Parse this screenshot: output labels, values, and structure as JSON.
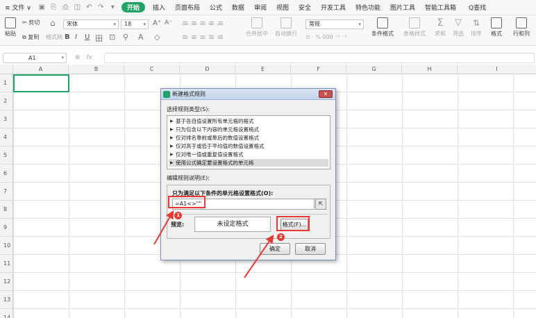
{
  "menubar": {
    "file": "≡ 文件 ∨",
    "tabs": [
      "开始",
      "插入",
      "页面布局",
      "公式",
      "数据",
      "审阅",
      "视图",
      "安全",
      "开发工具",
      "特色功能",
      "图片工具",
      "智能工具箱"
    ],
    "active_tab": "开始",
    "search": "Q查找"
  },
  "ribbon": {
    "cut": "✂ 剪切",
    "paste": "粘贴",
    "copy": "复制",
    "format_painter": "格式刷",
    "font": "宋体",
    "font_size": "18",
    "grow_font": "A⁺",
    "shrink_font": "A⁻",
    "bold": "B",
    "italic": "I",
    "underline": "U",
    "merge_center": "合并居中",
    "wrap": "自动换行",
    "number_format": "常规",
    "number_icons": "⊙ · % 000 ⁺⁰ ⁻⁰",
    "cond_format": "条件格式",
    "table_style": "表格样式",
    "sum": "求和",
    "filter": "筛选",
    "sort": "排序",
    "format": "格式",
    "rows_cols": "行和列"
  },
  "formula_bar": {
    "cell_ref": "A1",
    "fx": "fx",
    "formula": ""
  },
  "grid": {
    "columns": [
      "A",
      "B",
      "C",
      "D",
      "E",
      "F",
      "G",
      "H",
      "I"
    ],
    "rows": [
      "1",
      "2",
      "3",
      "4",
      "5",
      "6",
      "7",
      "8",
      "9",
      "10",
      "11",
      "12",
      "13",
      "14"
    ]
  },
  "dialog": {
    "title": "新建格式规则",
    "close": "✕",
    "rule_type_label": "选择规则类型(S):",
    "rules": [
      "基于各自值设置所有单元格的格式",
      "只为包含以下内容的单元格设置格式",
      "仅对排名靠前或靠后的数值设置格式",
      "仅对高于或低于平均值的数值设置格式",
      "仅对唯一值或重复值设置格式",
      "使用公式确定要设置格式的单元格"
    ],
    "selected_rule_index": 5,
    "edit_desc_label": "编辑规则说明(E):",
    "formula_label": "只为满足以下条件的单元格设置格式(O):",
    "formula_value": "=A1<>\"\"",
    "preview_label": "预览:",
    "preview_text": "未设定格式",
    "format_button": "格式(F)...",
    "ok_button": "确定",
    "cancel_button": "取消"
  },
  "annotations": {
    "badge1": "1",
    "badge2": "2",
    "highlight_color": "#e53935"
  },
  "colors": {
    "accent": "#21a366",
    "highlight": "#e53935"
  }
}
